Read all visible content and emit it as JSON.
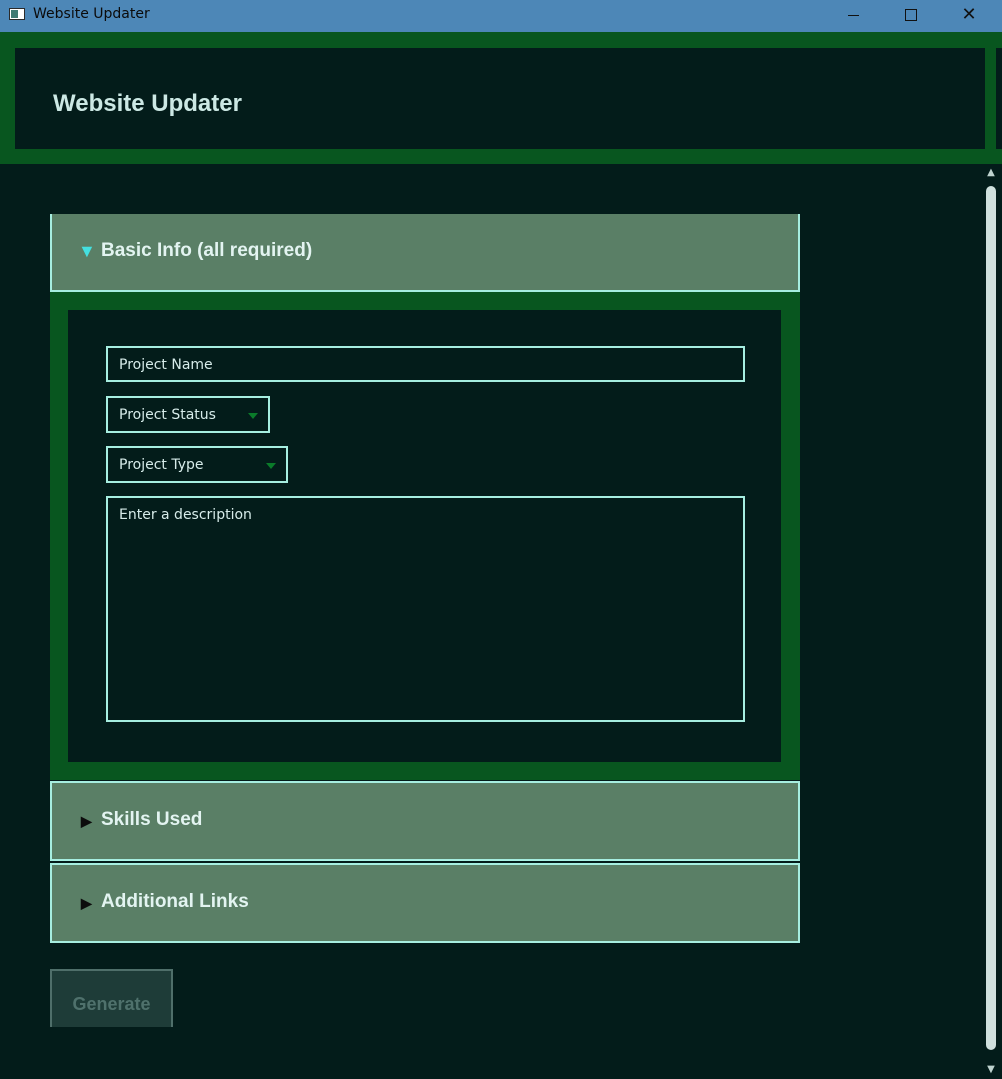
{
  "window": {
    "title": "Website Updater",
    "controls": {
      "minimize": "—",
      "maximize": "☐",
      "close": "✕"
    }
  },
  "header": {
    "title": "Website Updater"
  },
  "sections": [
    {
      "label": "Basic Info (all required)",
      "expanded": true,
      "icon": "triangle-down-icon"
    },
    {
      "label": "Skills Used",
      "expanded": false,
      "icon": "triangle-right-icon"
    },
    {
      "label": "Additional Links",
      "expanded": false,
      "icon": "triangle-right-icon"
    }
  ],
  "form": {
    "project_name_placeholder": "Project Name",
    "project_status_value": "Project Status",
    "project_type_value": "Project Type",
    "description_placeholder": "Enter a description"
  },
  "actions": {
    "generate_label": "Generate",
    "generate_enabled": false
  },
  "colors": {
    "background": "#031c1a",
    "accent_green": "#08561f",
    "section_header": "#5a7f66",
    "border": "#a6eee0",
    "titlebar": "#4d87b7"
  }
}
